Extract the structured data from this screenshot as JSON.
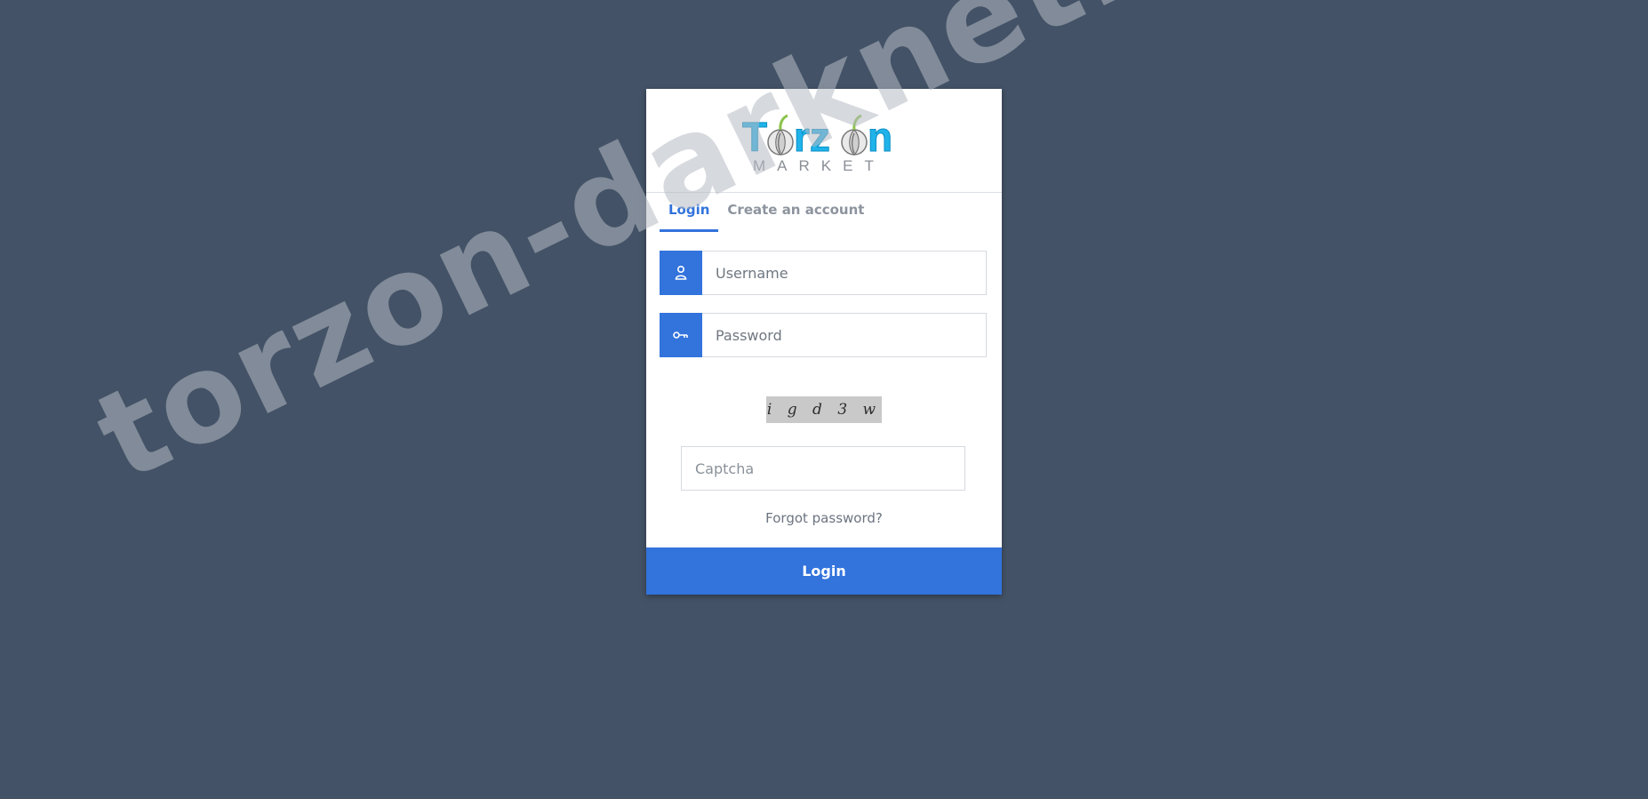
{
  "logo": {
    "title": "Torzon",
    "subtitle": "MARKET",
    "title_color": "#1fb3ea",
    "subtitle_color": "#8a8f96"
  },
  "tabs": [
    {
      "label": "Login",
      "active": true
    },
    {
      "label": "Create an account",
      "active": false
    }
  ],
  "form": {
    "username": {
      "placeholder": "Username",
      "icon": "user-icon"
    },
    "password": {
      "placeholder": "Password",
      "icon": "key-icon"
    },
    "captcha_image_text": "i g d 3 w",
    "captcha": {
      "placeholder": "Captcha"
    },
    "forgot_label": "Forgot password?",
    "submit_label": "Login"
  },
  "watermark": "torzon-darknet.bond",
  "colors": {
    "background": "#435266",
    "accent": "#3273dc"
  }
}
